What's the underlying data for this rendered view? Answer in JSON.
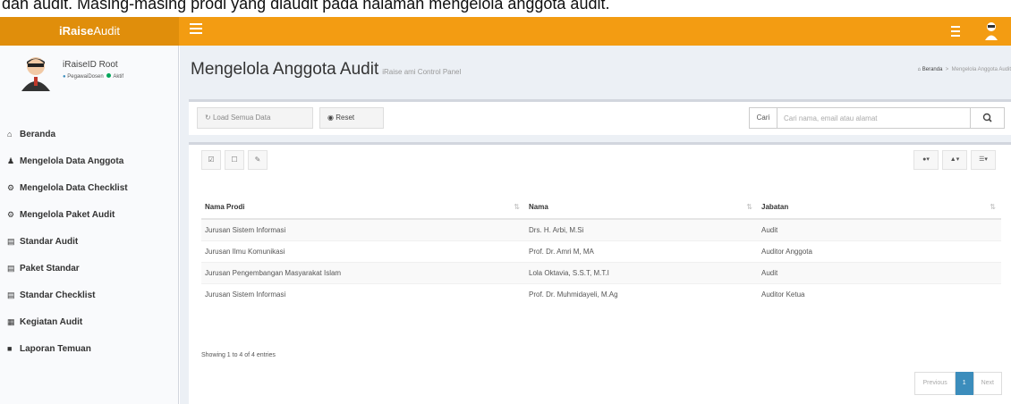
{
  "caption": "dan audit. Masing-masing prodi yang diaudit pada halaman mengelola anggota audit.",
  "app": {
    "brand_bold": "iRaise",
    "brand_rest": "Audit",
    "accent": "#f39c12"
  },
  "user": {
    "name": "iRaiseID Root",
    "role": "PegawaiDosen",
    "status": "Aktif"
  },
  "menu": [
    {
      "icon": "home-icon",
      "label": "Beranda"
    },
    {
      "icon": "users-icon",
      "label": "Mengelola Data Anggota"
    },
    {
      "icon": "settings-icon",
      "label": "Mengelola Data Checklist"
    },
    {
      "icon": "settings-icon",
      "label": "Mengelola Paket Audit"
    },
    {
      "icon": "book-icon",
      "label": "Standar Audit"
    },
    {
      "icon": "chart-icon",
      "label": "Paket Standar"
    },
    {
      "icon": "chart-icon",
      "label": "Standar Checklist"
    },
    {
      "icon": "calendar-icon",
      "label": "Kegiatan Audit"
    },
    {
      "icon": "folder-icon",
      "label": "Laporan Temuan"
    }
  ],
  "page": {
    "title": "Mengelola Anggota Audit",
    "subtitle": "iRaise ami Control Panel",
    "breadcrumb_home": "Beranda",
    "breadcrumb_current": "Mengelola Anggota Audit"
  },
  "toolbar": {
    "load_all": "Load Semua Data",
    "reset": "Reset",
    "search_label": "Cari",
    "search_placeholder": "Cari nama, email atau alamat"
  },
  "table": {
    "headers": [
      "Nama Prodi",
      "Nama",
      "Jabatan"
    ],
    "rows": [
      [
        "Jurusan Sistem Informasi",
        "Drs. H. Arbi, M.Si",
        "Audit"
      ],
      [
        "Jurusan Ilmu Komunikasi",
        "Prof. Dr. Amri M, MA",
        "Auditor Anggota"
      ],
      [
        "Jurusan Pengembangan Masyarakat Islam",
        "Lola Oktavia, S.S.T, M.T.I",
        "Audit"
      ],
      [
        "Jurusan Sistem Informasi",
        "Prof. Dr. Muhmidayeli, M.Ag",
        "Auditor Ketua"
      ]
    ],
    "info": "Showing 1 to 4 of 4 entries"
  },
  "pagination": {
    "previous": "Previous",
    "current": "1",
    "next": "Next"
  }
}
